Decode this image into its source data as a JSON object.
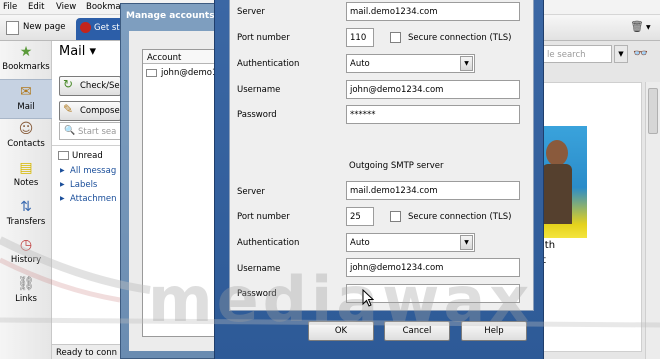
{
  "menu": [
    "File",
    "Edit",
    "View",
    "Bookma"
  ],
  "tabs": {
    "new_page": "New page",
    "active": "Get st"
  },
  "sidebar": [
    {
      "label": "Bookmarks",
      "icon": "bookmarks-icon"
    },
    {
      "label": "Mail",
      "icon": "mail-icon"
    },
    {
      "label": "Contacts",
      "icon": "contacts-icon"
    },
    {
      "label": "Notes",
      "icon": "notes-icon"
    },
    {
      "label": "Transfers",
      "icon": "transfers-icon"
    },
    {
      "label": "History",
      "icon": "history-icon"
    },
    {
      "label": "Links",
      "icon": "links-icon"
    }
  ],
  "mail_panel": {
    "title": "Mail",
    "check": "Check/Se",
    "compose": "Compose",
    "search_placeholder": "Start sea",
    "unread": "Unread",
    "all_messages": "All messag",
    "labels": "Labels",
    "attachments": "Attachmen"
  },
  "status_text": "Ready to conn",
  "right": {
    "search_placeholder": "le search",
    "text1": "ith",
    "text2": "t"
  },
  "manage_dialog": {
    "title": "Manage accounts",
    "column": "Account",
    "row": "john@demo1"
  },
  "incoming": {
    "server_label": "Server",
    "server": "mail.demo1234.com",
    "port_label": "Port number",
    "port": "110",
    "secure_label": "Secure connection (TLS)",
    "auth_label": "Authentication",
    "auth": "Auto",
    "user_label": "Username",
    "user": "john@demo1234.com",
    "pass_label": "Password",
    "pass": "******"
  },
  "outgoing": {
    "header": "Outgoing SMTP server",
    "server_label": "Server",
    "server": "mail.demo1234.com",
    "port_label": "Port number",
    "port": "25",
    "secure_label": "Secure connection (TLS)",
    "auth_label": "Authentication",
    "auth": "Auto",
    "user_label": "Username",
    "user": "john@demo1234.com",
    "pass_label": "Password",
    "pass": ""
  },
  "buttons": {
    "ok": "OK",
    "cancel": "Cancel",
    "help": "Help"
  },
  "watermark": "mediawax"
}
